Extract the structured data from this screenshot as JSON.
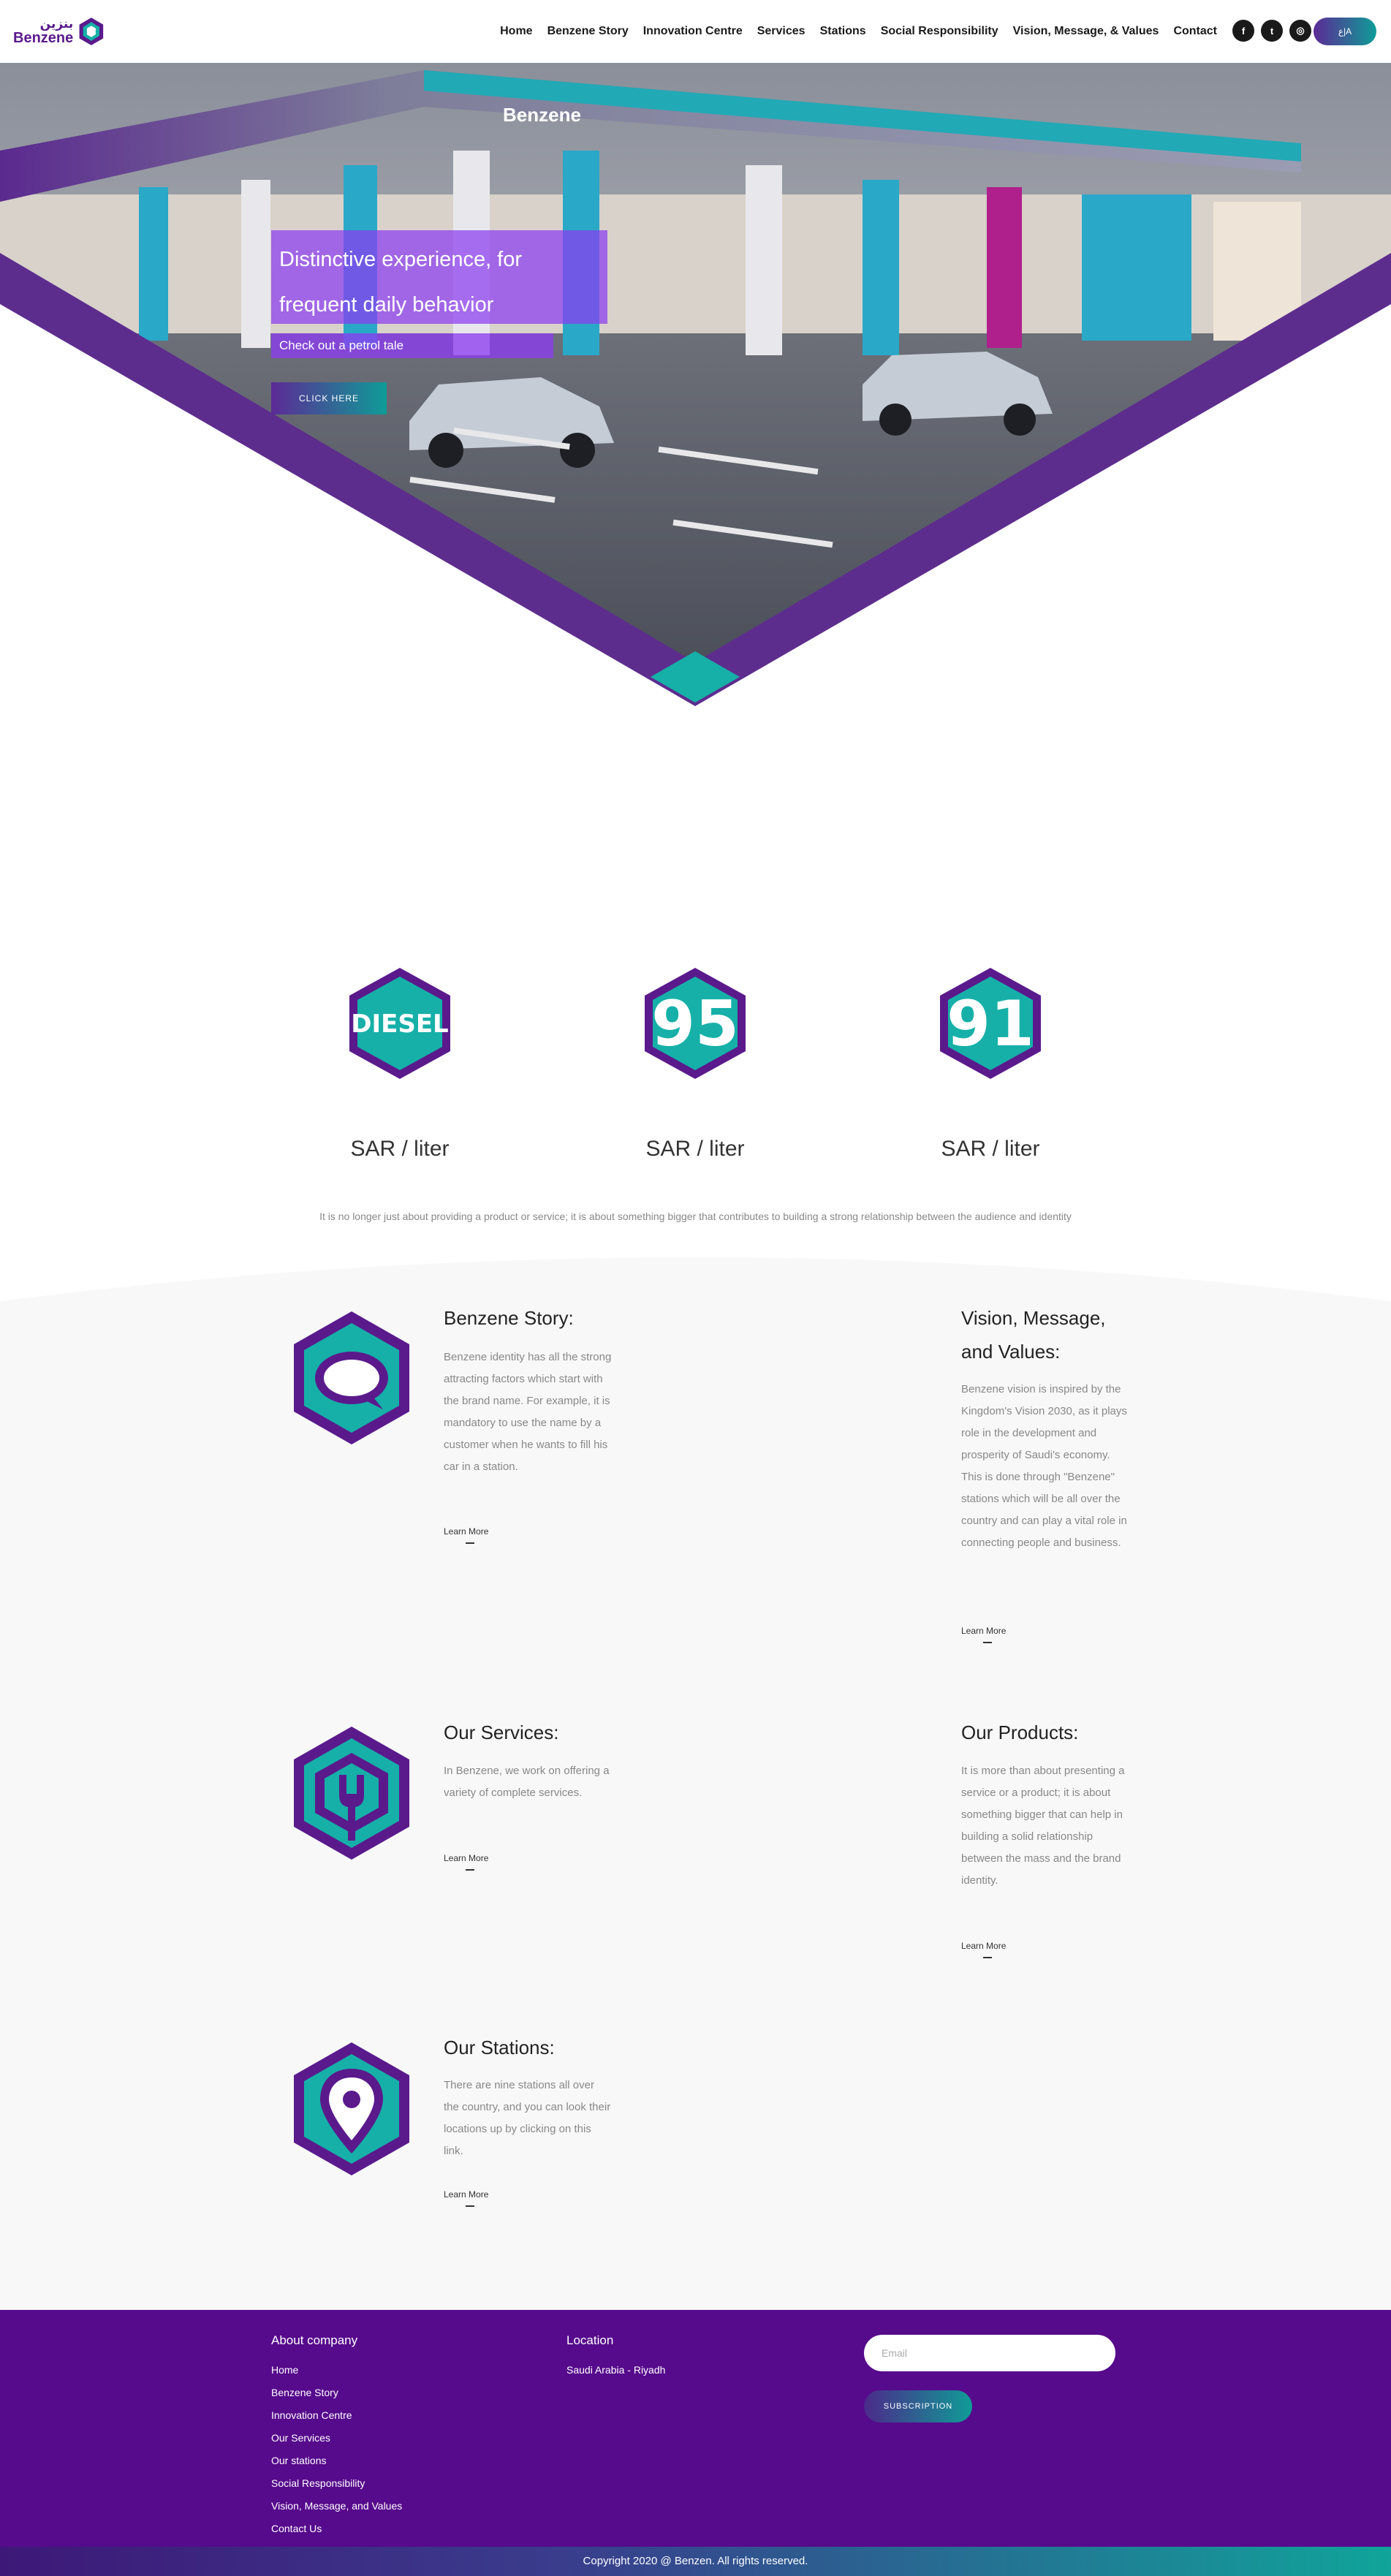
{
  "brand": {
    "name_en": "Benzene",
    "name_ar": "بنزين",
    "primary": "#5a1a8c",
    "accent": "#16b0a8"
  },
  "nav": {
    "items": [
      "Home",
      "Benzene Story",
      "Innovation Centre",
      "Services",
      "Stations",
      "Social Responsibility",
      "Vision, Message, & Values",
      "Contact"
    ],
    "social": [
      {
        "label": "f",
        "icon": "facebook-icon"
      },
      {
        "label": "t",
        "icon": "twitter-icon"
      },
      {
        "label": "◎",
        "icon": "instagram-icon"
      }
    ],
    "lang_label": "ع|A"
  },
  "hero": {
    "title": "Distinctive experience, for frequent daily behavior",
    "subtitle": "Check out a petrol tale",
    "cta": "CLICK HERE",
    "sign_text": "Benzene"
  },
  "fuel": {
    "items": [
      {
        "label": "DIESEL",
        "unit": "SAR / liter"
      },
      {
        "label": "95",
        "unit": "SAR / liter"
      },
      {
        "label": "91",
        "unit": "SAR / liter"
      }
    ],
    "tagline": "It is no longer just about providing a product or service; it is about something bigger that contributes to building a strong relationship between the audience and identity"
  },
  "cards": {
    "story": {
      "title": "Benzene Story:",
      "body": "Benzene identity has all the strong attracting factors which start with the brand name. For example, it is mandatory to use the name by a customer when he wants to fill his car in a station.",
      "link": "Learn More",
      "icon": "chat-bubble-icon"
    },
    "vision": {
      "title": "Vision, Message, and Values:",
      "body": "Benzene vision is inspired by the Kingdom's Vision 2030, as it plays role in the development and prosperity of Saudi's economy. This is done through \"Benzene\" stations which will be all over the country and can play a vital role in connecting people and business.",
      "link": "Learn More"
    },
    "services": {
      "title": "Our Services:",
      "body": "In Benzene, we work on offering a variety of complete services.",
      "link": "Learn More",
      "icon": "wrench-icon"
    },
    "products": {
      "title": "Our Products:",
      "body": "It is more than about presenting a service or a product; it is about something bigger that can help in building a solid relationship between the mass and the brand identity.",
      "link": "Learn More"
    },
    "stations": {
      "title": "Our Stations:",
      "body": "There are nine stations all over the country, and you can look their locations up by clicking on this link.",
      "link": "Learn More",
      "icon": "location-pin-icon"
    }
  },
  "footer": {
    "about_heading": "About company",
    "links": [
      "Home",
      "Benzene Story",
      "Innovation Centre",
      "Our Services",
      "Our stations",
      "Social Responsibility",
      "Vision, Message, and Values",
      "Contact Us"
    ],
    "location_heading": "Location",
    "location": "Saudi Arabia - Riyadh",
    "email_placeholder": "Email",
    "subscribe": "SUBSCRIPTION",
    "copyright": "Copyright 2020 @ Benzen. All rights reserved."
  }
}
